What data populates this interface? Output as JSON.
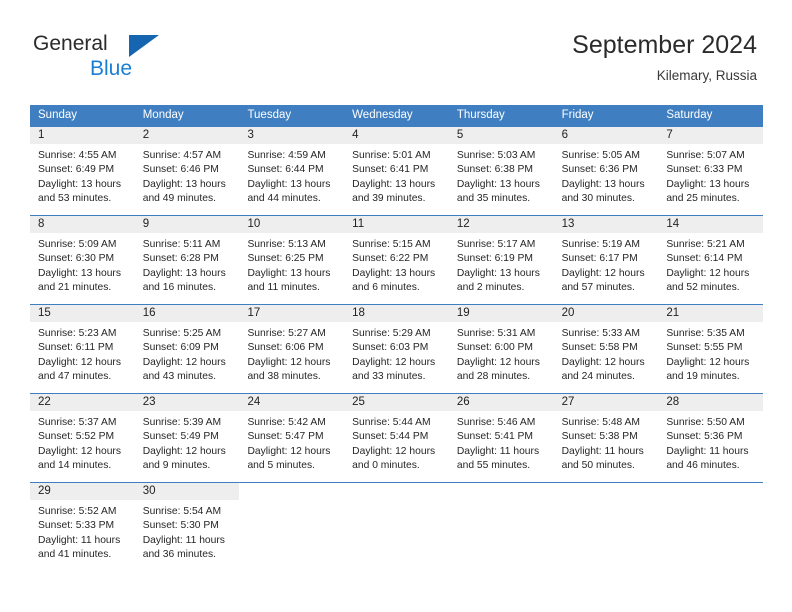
{
  "brand": {
    "name_part1": "General",
    "name_part2": "Blue",
    "accent_color": "#1a7fd4",
    "triangle_color": "#1565b0"
  },
  "header": {
    "title": "September 2024",
    "subtitle": "Kilemary, Russia"
  },
  "theme": {
    "header_band": "#3f7fc1",
    "daynum_band": "#eeeeee",
    "text": "#262626"
  },
  "weekdays": [
    "Sunday",
    "Monday",
    "Tuesday",
    "Wednesday",
    "Thursday",
    "Friday",
    "Saturday"
  ],
  "weeks": [
    [
      {
        "day": "1",
        "sunrise": "Sunrise: 4:55 AM",
        "sunset": "Sunset: 6:49 PM",
        "daylight1": "Daylight: 13 hours",
        "daylight2": "and 53 minutes."
      },
      {
        "day": "2",
        "sunrise": "Sunrise: 4:57 AM",
        "sunset": "Sunset: 6:46 PM",
        "daylight1": "Daylight: 13 hours",
        "daylight2": "and 49 minutes."
      },
      {
        "day": "3",
        "sunrise": "Sunrise: 4:59 AM",
        "sunset": "Sunset: 6:44 PM",
        "daylight1": "Daylight: 13 hours",
        "daylight2": "and 44 minutes."
      },
      {
        "day": "4",
        "sunrise": "Sunrise: 5:01 AM",
        "sunset": "Sunset: 6:41 PM",
        "daylight1": "Daylight: 13 hours",
        "daylight2": "and 39 minutes."
      },
      {
        "day": "5",
        "sunrise": "Sunrise: 5:03 AM",
        "sunset": "Sunset: 6:38 PM",
        "daylight1": "Daylight: 13 hours",
        "daylight2": "and 35 minutes."
      },
      {
        "day": "6",
        "sunrise": "Sunrise: 5:05 AM",
        "sunset": "Sunset: 6:36 PM",
        "daylight1": "Daylight: 13 hours",
        "daylight2": "and 30 minutes."
      },
      {
        "day": "7",
        "sunrise": "Sunrise: 5:07 AM",
        "sunset": "Sunset: 6:33 PM",
        "daylight1": "Daylight: 13 hours",
        "daylight2": "and 25 minutes."
      }
    ],
    [
      {
        "day": "8",
        "sunrise": "Sunrise: 5:09 AM",
        "sunset": "Sunset: 6:30 PM",
        "daylight1": "Daylight: 13 hours",
        "daylight2": "and 21 minutes."
      },
      {
        "day": "9",
        "sunrise": "Sunrise: 5:11 AM",
        "sunset": "Sunset: 6:28 PM",
        "daylight1": "Daylight: 13 hours",
        "daylight2": "and 16 minutes."
      },
      {
        "day": "10",
        "sunrise": "Sunrise: 5:13 AM",
        "sunset": "Sunset: 6:25 PM",
        "daylight1": "Daylight: 13 hours",
        "daylight2": "and 11 minutes."
      },
      {
        "day": "11",
        "sunrise": "Sunrise: 5:15 AM",
        "sunset": "Sunset: 6:22 PM",
        "daylight1": "Daylight: 13 hours",
        "daylight2": "and 6 minutes."
      },
      {
        "day": "12",
        "sunrise": "Sunrise: 5:17 AM",
        "sunset": "Sunset: 6:19 PM",
        "daylight1": "Daylight: 13 hours",
        "daylight2": "and 2 minutes."
      },
      {
        "day": "13",
        "sunrise": "Sunrise: 5:19 AM",
        "sunset": "Sunset: 6:17 PM",
        "daylight1": "Daylight: 12 hours",
        "daylight2": "and 57 minutes."
      },
      {
        "day": "14",
        "sunrise": "Sunrise: 5:21 AM",
        "sunset": "Sunset: 6:14 PM",
        "daylight1": "Daylight: 12 hours",
        "daylight2": "and 52 minutes."
      }
    ],
    [
      {
        "day": "15",
        "sunrise": "Sunrise: 5:23 AM",
        "sunset": "Sunset: 6:11 PM",
        "daylight1": "Daylight: 12 hours",
        "daylight2": "and 47 minutes."
      },
      {
        "day": "16",
        "sunrise": "Sunrise: 5:25 AM",
        "sunset": "Sunset: 6:09 PM",
        "daylight1": "Daylight: 12 hours",
        "daylight2": "and 43 minutes."
      },
      {
        "day": "17",
        "sunrise": "Sunrise: 5:27 AM",
        "sunset": "Sunset: 6:06 PM",
        "daylight1": "Daylight: 12 hours",
        "daylight2": "and 38 minutes."
      },
      {
        "day": "18",
        "sunrise": "Sunrise: 5:29 AM",
        "sunset": "Sunset: 6:03 PM",
        "daylight1": "Daylight: 12 hours",
        "daylight2": "and 33 minutes."
      },
      {
        "day": "19",
        "sunrise": "Sunrise: 5:31 AM",
        "sunset": "Sunset: 6:00 PM",
        "daylight1": "Daylight: 12 hours",
        "daylight2": "and 28 minutes."
      },
      {
        "day": "20",
        "sunrise": "Sunrise: 5:33 AM",
        "sunset": "Sunset: 5:58 PM",
        "daylight1": "Daylight: 12 hours",
        "daylight2": "and 24 minutes."
      },
      {
        "day": "21",
        "sunrise": "Sunrise: 5:35 AM",
        "sunset": "Sunset: 5:55 PM",
        "daylight1": "Daylight: 12 hours",
        "daylight2": "and 19 minutes."
      }
    ],
    [
      {
        "day": "22",
        "sunrise": "Sunrise: 5:37 AM",
        "sunset": "Sunset: 5:52 PM",
        "daylight1": "Daylight: 12 hours",
        "daylight2": "and 14 minutes."
      },
      {
        "day": "23",
        "sunrise": "Sunrise: 5:39 AM",
        "sunset": "Sunset: 5:49 PM",
        "daylight1": "Daylight: 12 hours",
        "daylight2": "and 9 minutes."
      },
      {
        "day": "24",
        "sunrise": "Sunrise: 5:42 AM",
        "sunset": "Sunset: 5:47 PM",
        "daylight1": "Daylight: 12 hours",
        "daylight2": "and 5 minutes."
      },
      {
        "day": "25",
        "sunrise": "Sunrise: 5:44 AM",
        "sunset": "Sunset: 5:44 PM",
        "daylight1": "Daylight: 12 hours",
        "daylight2": "and 0 minutes."
      },
      {
        "day": "26",
        "sunrise": "Sunrise: 5:46 AM",
        "sunset": "Sunset: 5:41 PM",
        "daylight1": "Daylight: 11 hours",
        "daylight2": "and 55 minutes."
      },
      {
        "day": "27",
        "sunrise": "Sunrise: 5:48 AM",
        "sunset": "Sunset: 5:38 PM",
        "daylight1": "Daylight: 11 hours",
        "daylight2": "and 50 minutes."
      },
      {
        "day": "28",
        "sunrise": "Sunrise: 5:50 AM",
        "sunset": "Sunset: 5:36 PM",
        "daylight1": "Daylight: 11 hours",
        "daylight2": "and 46 minutes."
      }
    ],
    [
      {
        "day": "29",
        "sunrise": "Sunrise: 5:52 AM",
        "sunset": "Sunset: 5:33 PM",
        "daylight1": "Daylight: 11 hours",
        "daylight2": "and 41 minutes."
      },
      {
        "day": "30",
        "sunrise": "Sunrise: 5:54 AM",
        "sunset": "Sunset: 5:30 PM",
        "daylight1": "Daylight: 11 hours",
        "daylight2": "and 36 minutes."
      },
      {
        "day": "",
        "sunrise": "",
        "sunset": "",
        "daylight1": "",
        "daylight2": ""
      },
      {
        "day": "",
        "sunrise": "",
        "sunset": "",
        "daylight1": "",
        "daylight2": ""
      },
      {
        "day": "",
        "sunrise": "",
        "sunset": "",
        "daylight1": "",
        "daylight2": ""
      },
      {
        "day": "",
        "sunrise": "",
        "sunset": "",
        "daylight1": "",
        "daylight2": ""
      },
      {
        "day": "",
        "sunrise": "",
        "sunset": "",
        "daylight1": "",
        "daylight2": ""
      }
    ]
  ]
}
